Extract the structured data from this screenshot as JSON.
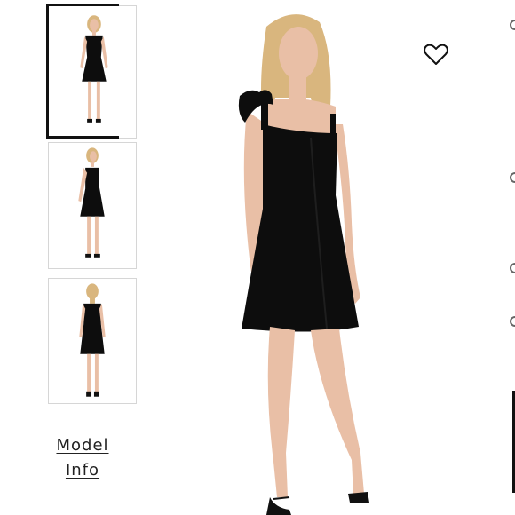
{
  "thumbnails": [
    {
      "view": "front",
      "selected": true
    },
    {
      "view": "side",
      "selected": false
    },
    {
      "view": "back",
      "selected": false
    }
  ],
  "model_info": {
    "line1": "Model",
    "line2": "Info"
  },
  "icons": {
    "favorite": "heart-outline-icon"
  },
  "colors": {
    "dress": "#0d0d0d",
    "selection_border": "#111111",
    "skin": "#e9bfa6",
    "hair": "#d9b67e"
  }
}
